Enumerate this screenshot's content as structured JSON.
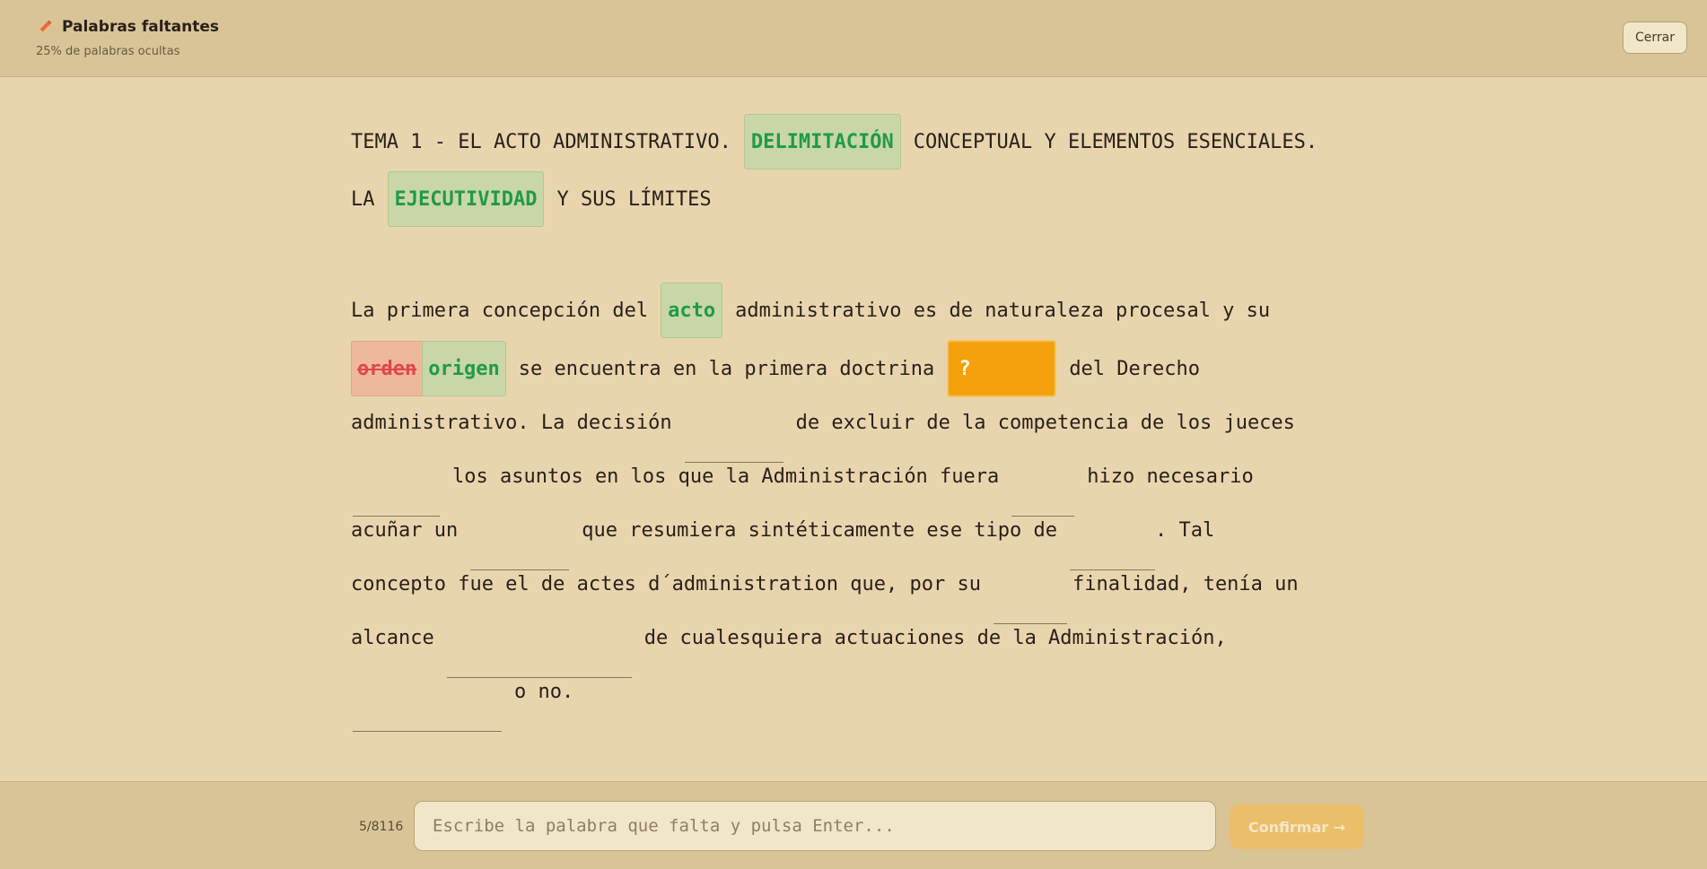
{
  "header": {
    "title": "Palabras faltantes",
    "subtitle": "25% de palabras ocultas",
    "close_label": "Cerrar",
    "icon": "pencil-icon"
  },
  "text": {
    "l1a": "TEMA 1 - EL ACTO ADMINISTRATIVO.",
    "l1b": "DELIMITACIÓN",
    "l1c": "CONCEPTUAL Y ELEMENTOS ESENCIALES.",
    "l2a": "LA",
    "l2b": "EJECUTIVIDAD",
    "l2c": "Y SUS LÍMITES",
    "l3a": "La primera concepción del",
    "l3b": "acto",
    "l3c": "administrativo es de naturaleza procesal y su",
    "l4_wrong": "orden",
    "l4_fixed": "origen",
    "l4a": "se encuentra en la primera doctrina",
    "l4_current": "?",
    "l4b": "del Derecho",
    "l5a": "administrativo. La decisión",
    "l5b": "de excluir de la competencia de los jueces",
    "l6a": "los asuntos en los que la Administración fuera",
    "l6b": "hizo necesario",
    "l7a": "acuñar un",
    "l7b": "que resumiera sintéticamente ese tipo de",
    "l7c": ". Tal",
    "l8a": "concepto fue el de actes d´administration que, por su",
    "l8b": "finalidad, tenía un",
    "l9a": "alcance",
    "l9b": "de cualesquiera actuaciones de la Administración,",
    "l10a": "o no."
  },
  "footer": {
    "counter": "5/8116",
    "input_placeholder": "Escribe la palabra que falta y pulsa Enter...",
    "input_value": "",
    "confirm_label": "Confirmar →"
  },
  "colors": {
    "background": "#e8d5ae",
    "header": "#d9c498",
    "correct": "#1f9a4a",
    "wrong": "#e04848",
    "current": "#f5a10e"
  }
}
